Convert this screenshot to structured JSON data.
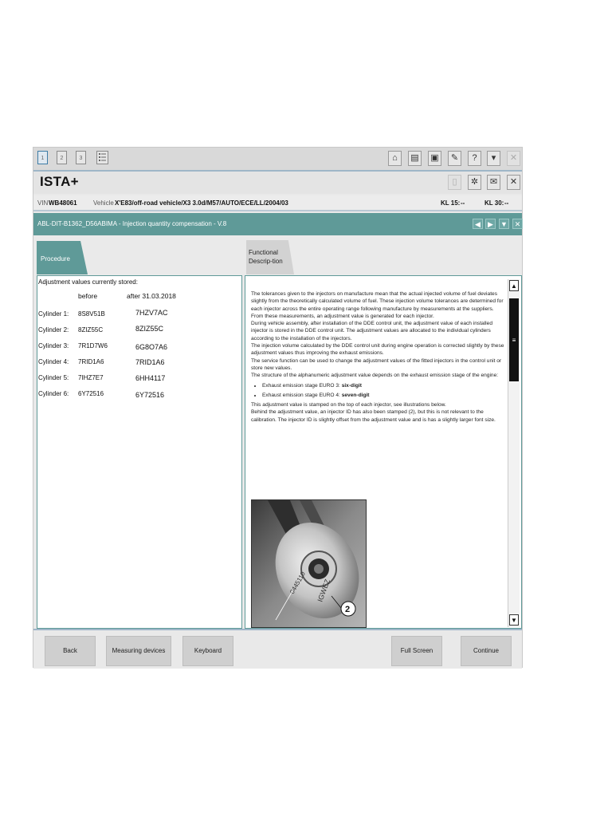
{
  "toolbar": {
    "tabs": [
      "1",
      "2",
      "3"
    ],
    "icons": [
      "home-icon",
      "document-icon",
      "print-icon",
      "wrench-icon",
      "help-icon",
      "save-icon",
      "close-icon"
    ]
  },
  "app": {
    "title": "ISTA+"
  },
  "titlebar_icons": [
    "save-disabled-icon",
    "settings-icon",
    "mail-icon",
    "close-icon"
  ],
  "vehicle": {
    "vin_label": "VIN",
    "vin": "WB48061",
    "vehicle_label": "Vehicle",
    "vehicle": "X'E83/off-road vehicle/X3 3.0d/M57/AUTO/ECE/LL/2004/03",
    "kl15_label": "KL 15:",
    "kl15_value": "--",
    "kl30_label": "KL 30:",
    "kl30_value": "--"
  },
  "header": {
    "title": "ABL-DIT-B1362_D56ABIMA - Injection quantity compensation - V.8"
  },
  "tabs": {
    "procedure": "Procedure",
    "functional": "Functional Descrip-tion"
  },
  "adjustment": {
    "title": "Adjustment values currently stored:",
    "col_before": "before",
    "col_after": "after 31.03.2018",
    "rows": [
      {
        "label": "Cylinder 1:",
        "before": "8S8V51B",
        "after": "7HZV7AC"
      },
      {
        "label": "Cylinder 2:",
        "before": "8ZIZ55C",
        "after": "8ZIZ55C"
      },
      {
        "label": "Cylinder 3:",
        "before": "7R1D7W6",
        "after": "6G8O7A6"
      },
      {
        "label": "Cylinder 4:",
        "before": "7RID1A6",
        "after": "7RID1A6"
      },
      {
        "label": "Cylinder 5:",
        "before": "7IHZ7E7",
        "after": "6HH4117"
      },
      {
        "label": "Cylinder 6:",
        "before": "6Y72516",
        "after": "6Y72516"
      }
    ]
  },
  "description": {
    "p1": "The tolerances given to the injectors on manufacture mean that the actual injected volume of fuel deviates slightly from the theoretically calculated volume of fuel. These injection volume tolerances are determined for each injector across the entire operating range following manufacture by measurements at the suppliers. From these measurements, an adjustment value is generated for each injector.",
    "p2": "During vehicle assembly, after installation of the DDE control unit, the adjustment value of each installed injector is stored in the DDE control unit. The adjustment values are allocated to the individual cylinders according to the installation of the injectors.",
    "p3": "The injection volume calculated by the DDE control unit during engine operation is corrected slightly by these adjustment values thus improving the exhaust emissions.",
    "p4": "The service function can be used to change the adjustment values of the fitted injectors in the control unit or store new values.",
    "p5": "The structure of the alphanumeric adjustment value depends on the exhaust emission stage of the engine:",
    "bullet1_prefix": "Exhaust emission stage EURO 3: ",
    "bullet1_bold": "six-digit",
    "bullet2_prefix": "Exhaust emission stage EURO 4: ",
    "bullet2_bold": "seven-digit",
    "p6": "This adjustment value is stamped on the top of each injector, see illustrations below.",
    "p7": "Behind the adjustment value, an injector ID has also been stamped (2), but this is not relevant to the calibration. The injector ID is slightly offset from the adjustment value and is has a slightly larger font size.",
    "photo_callout": "2"
  },
  "footer": {
    "back": "Back",
    "measuring": "Measuring devices",
    "keyboard": "Keyboard",
    "fullscreen": "Full Screen",
    "continue": "Continue"
  },
  "colors": {
    "accent": "#5f9a98",
    "toolbar": "#d9d9d9"
  }
}
